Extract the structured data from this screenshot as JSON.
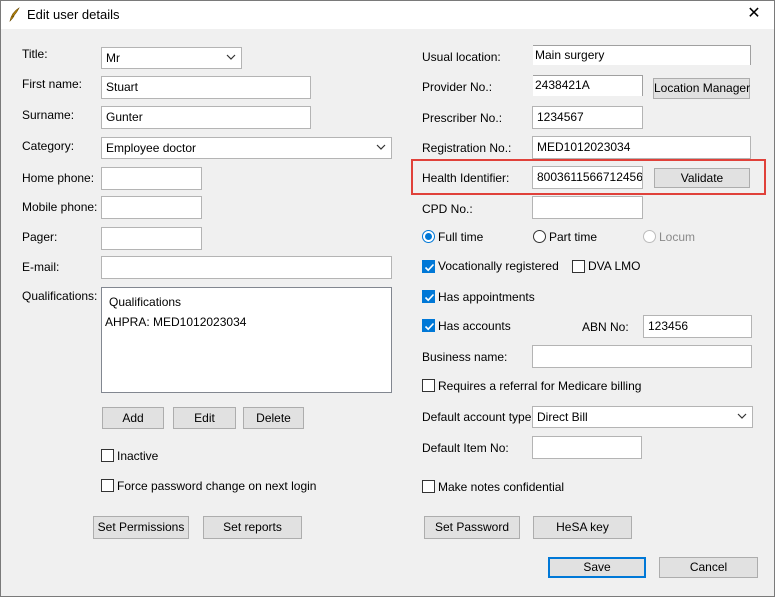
{
  "window": {
    "title": "Edit user details",
    "icon": "quill-icon",
    "close_glyph": "✕"
  },
  "left": {
    "title_label": "Title:",
    "title_value": "Mr",
    "first_name_label": "First name:",
    "first_name_value": "Stuart",
    "surname_label": "Surname:",
    "surname_value": "Gunter",
    "category_label": "Category:",
    "category_value": "Employee doctor",
    "home_phone_label": "Home phone:",
    "home_phone_value": "",
    "mobile_phone_label": "Mobile phone:",
    "mobile_phone_value": "",
    "pager_label": "Pager:",
    "pager_value": "",
    "email_label": "E-mail:",
    "email_value": "",
    "qualifications_label": "Qualifications:",
    "qualifications_header": "Qualifications",
    "qualifications_items": [
      "AHPRA: MED1012023034"
    ],
    "add_label": "Add",
    "edit_label": "Edit",
    "delete_label": "Delete",
    "inactive_label": "Inactive",
    "inactive_checked": false,
    "force_pw_label": "Force password change on next login",
    "force_pw_checked": false,
    "set_permissions_label": "Set Permissions",
    "set_reports_label": "Set reports"
  },
  "right": {
    "usual_location_label": "Usual location:",
    "usual_location_value": "Main surgery",
    "provider_no_label": "Provider No.:",
    "provider_no_value": "2438421A",
    "location_manager_label": "Location Manager",
    "prescriber_no_label": "Prescriber No.:",
    "prescriber_no_value": "1234567",
    "registration_no_label": "Registration No.:",
    "registration_no_value": "MED1012023034",
    "health_identifier_label": "Health Identifier:",
    "health_identifier_value": "8003611566712456",
    "validate_label": "Validate",
    "cpd_no_label": "CPD No.:",
    "cpd_no_value": "",
    "full_time_label": "Full time",
    "part_time_label": "Part time",
    "locum_label": "Locum",
    "employment_selected": "Full time",
    "vocational_label": "Vocationally registered",
    "vocational_checked": true,
    "dva_lmo_label": "DVA LMO",
    "dva_lmo_checked": false,
    "has_appointments_label": "Has appointments",
    "has_appointments_checked": true,
    "has_accounts_label": "Has accounts",
    "has_accounts_checked": true,
    "abn_label": "ABN No:",
    "abn_value": "123456",
    "business_name_label": "Business name:",
    "business_name_value": "",
    "referral_label": "Requires a referral for Medicare billing",
    "referral_checked": false,
    "default_account_type_label": "Default account type:",
    "default_account_type_value": "Direct Bill",
    "default_item_no_label": "Default Item No:",
    "default_item_no_value": "",
    "notes_confidential_label": "Make notes confidential",
    "notes_confidential_checked": false,
    "set_password_label": "Set Password",
    "hesa_key_label": "HeSA key"
  },
  "footer": {
    "save_label": "Save",
    "cancel_label": "Cancel"
  },
  "colors": {
    "accent": "#0078d7",
    "highlight": "#e0413a"
  }
}
